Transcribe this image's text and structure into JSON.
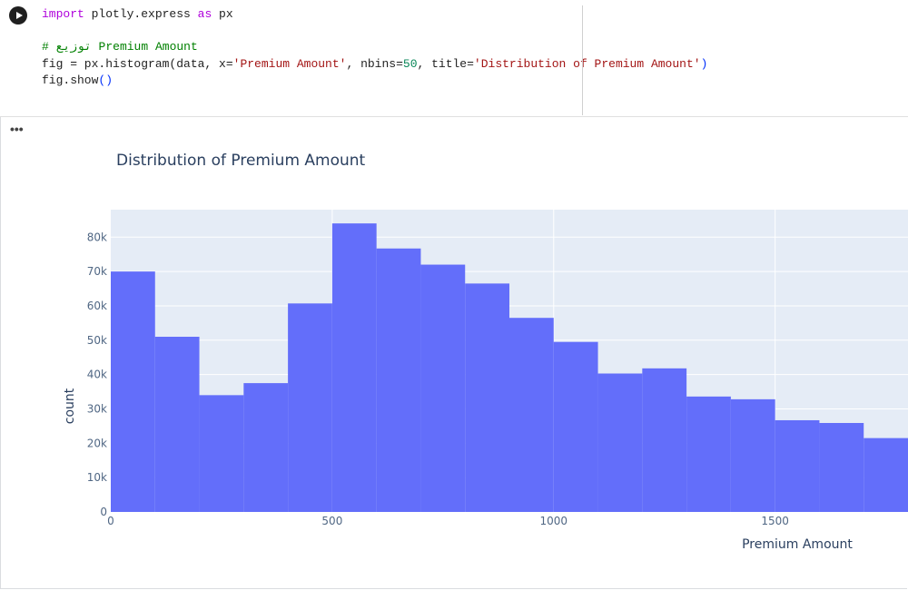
{
  "code": {
    "line1": {
      "kw1": "import",
      "mid": " plotly.express ",
      "kw2": "as",
      "tail": " px"
    },
    "comment": "# توزيع Premium Amount",
    "line3": {
      "a": "fig = px.histogram(data, x=",
      "s1": "'Premium Amount'",
      "b": ", nbins=",
      "n": "50",
      "c": ", title=",
      "s2": "'Distribution of Premium Amount'",
      "d": ")"
    },
    "line4": {
      "a": "fig.show",
      "p": "()"
    }
  },
  "output": {
    "menu_label": "•••"
  },
  "colors": {
    "bar": "#636efa",
    "plot_bg": "#e5ecf6",
    "grid": "#ffffff"
  },
  "chart_data": {
    "type": "bar",
    "title": "Distribution of Premium Amount",
    "xlabel": "Premium Amount",
    "ylabel": "count",
    "bin_width": 100,
    "bin_starts": [
      0,
      100,
      200,
      300,
      400,
      500,
      600,
      700,
      800,
      900,
      1000,
      1100,
      1200,
      1300,
      1400,
      1500,
      1600,
      1700,
      1800
    ],
    "values": [
      70000,
      51000,
      34000,
      37500,
      60700,
      84000,
      76700,
      72000,
      66500,
      56500,
      49500,
      40300,
      41800,
      33600,
      32800,
      26700,
      25900,
      21500,
      0
    ],
    "xlim": [
      0,
      1800
    ],
    "ylim": [
      0,
      88000
    ],
    "xticks": [
      0,
      500,
      1000,
      1500
    ],
    "xtick_labels": [
      "0",
      "500",
      "1000",
      "1500"
    ],
    "yticks": [
      0,
      10000,
      20000,
      30000,
      40000,
      50000,
      60000,
      70000,
      80000
    ],
    "ytick_labels": [
      "0",
      "10k",
      "20k",
      "30k",
      "40k",
      "50k",
      "60k",
      "70k",
      "80k"
    ],
    "grid": true
  }
}
